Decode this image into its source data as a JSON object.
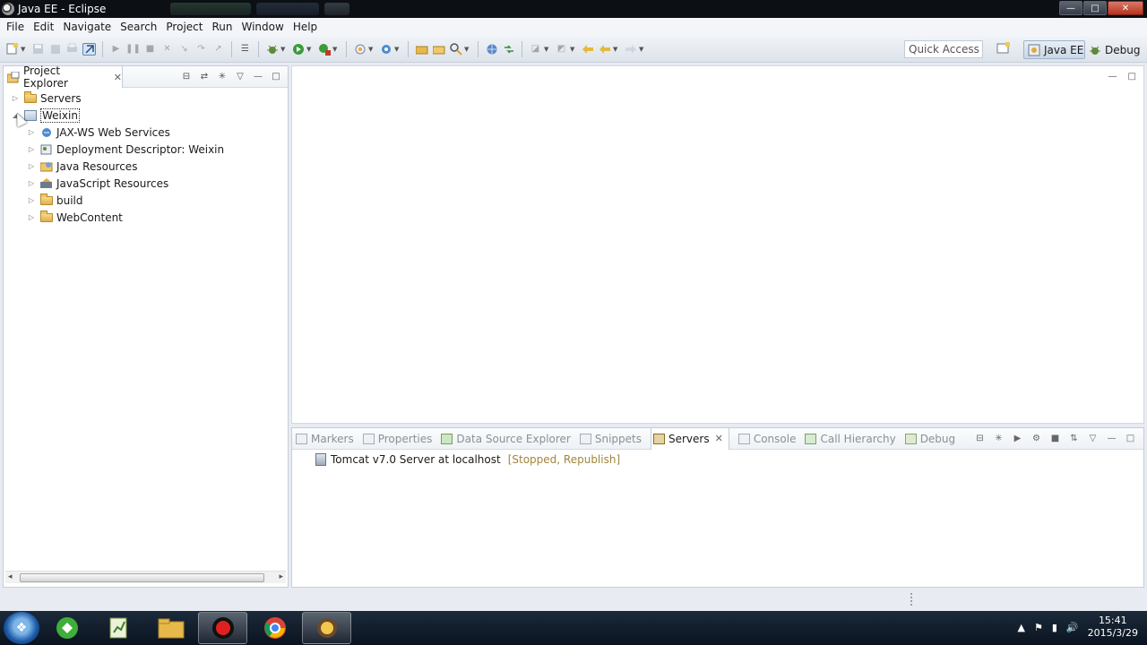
{
  "window": {
    "title": "Java EE - Eclipse",
    "min_glyph": "—",
    "max_glyph": "□",
    "close_glyph": "✕"
  },
  "menu": [
    "File",
    "Edit",
    "Navigate",
    "Search",
    "Project",
    "Run",
    "Window",
    "Help"
  ],
  "toolbar": {
    "quick_access_placeholder": "Quick Access",
    "perspectives": {
      "javaee": "Java EE",
      "debug": "Debug"
    }
  },
  "project_explorer": {
    "tab_label": "Project Explorer",
    "close_glyph": "✕",
    "items": [
      {
        "label": "Servers",
        "icon": "folder-icon",
        "level": 0,
        "expanded": false
      },
      {
        "label": "Weixin",
        "icon": "web-project-icon",
        "level": 0,
        "expanded": true,
        "selected": true
      },
      {
        "label": "JAX-WS Web Services",
        "icon": "webservice-icon",
        "level": 1
      },
      {
        "label": "Deployment Descriptor: Weixin",
        "icon": "descriptor-icon",
        "level": 1
      },
      {
        "label": "Java Resources",
        "icon": "java-resources-icon",
        "level": 1
      },
      {
        "label": "JavaScript Resources",
        "icon": "javascript-resources-icon",
        "level": 1
      },
      {
        "label": "build",
        "icon": "folder-icon",
        "level": 1
      },
      {
        "label": "WebContent",
        "icon": "folder-icon",
        "level": 1
      }
    ]
  },
  "bottom_panel": {
    "tabs": [
      "Markers",
      "Properties",
      "Data Source Explorer",
      "Snippets",
      "Servers",
      "Console",
      "Call Hierarchy",
      "Debug"
    ],
    "active_tab": "Servers",
    "server": {
      "name": "Tomcat v7.0 Server at localhost",
      "state": "[Stopped, Republish]"
    }
  },
  "taskbar": {
    "clock_time": "15:41",
    "clock_date": "2015/3/29"
  },
  "colors": {
    "accent": "#5b87c2",
    "server_state": "#a0853a",
    "taskbar": "#0b1320"
  }
}
